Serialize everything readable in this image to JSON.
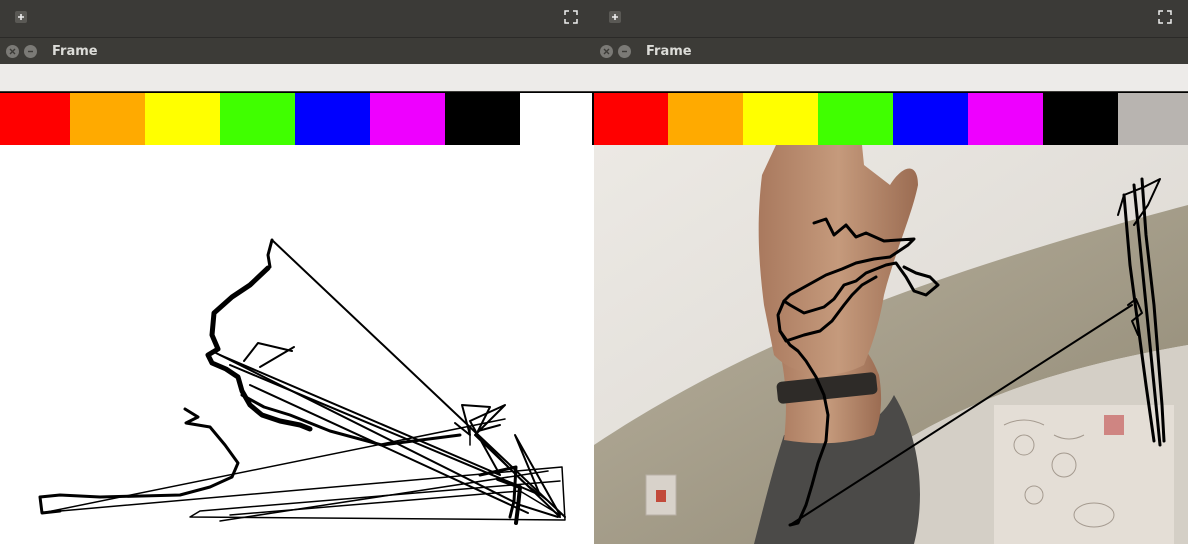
{
  "windows": [
    {
      "id": "left",
      "title": "Frame",
      "toolbar_left_icon": "plus-box-icon",
      "toolbar_right_icon": "fullscreen-icon",
      "palette": [
        "#ff0000",
        "#ffaa00",
        "#ffff00",
        "#40ff00",
        "#0000ff",
        "#ee00ff",
        "#000000",
        "#ffffff"
      ],
      "canvas_background": "#ffffff",
      "stroke_color": "#000000"
    },
    {
      "id": "right",
      "title": "Frame",
      "toolbar_left_icon": "plus-box-icon",
      "toolbar_right_icon": "fullscreen-icon",
      "palette": [
        "#ff0000",
        "#ffaa00",
        "#ffff00",
        "#40ff00",
        "#0000ff",
        "#ee00ff",
        "#000000",
        "#b8b4b0"
      ],
      "canvas_background": "camera-feed",
      "stroke_color": "#000000"
    }
  ]
}
